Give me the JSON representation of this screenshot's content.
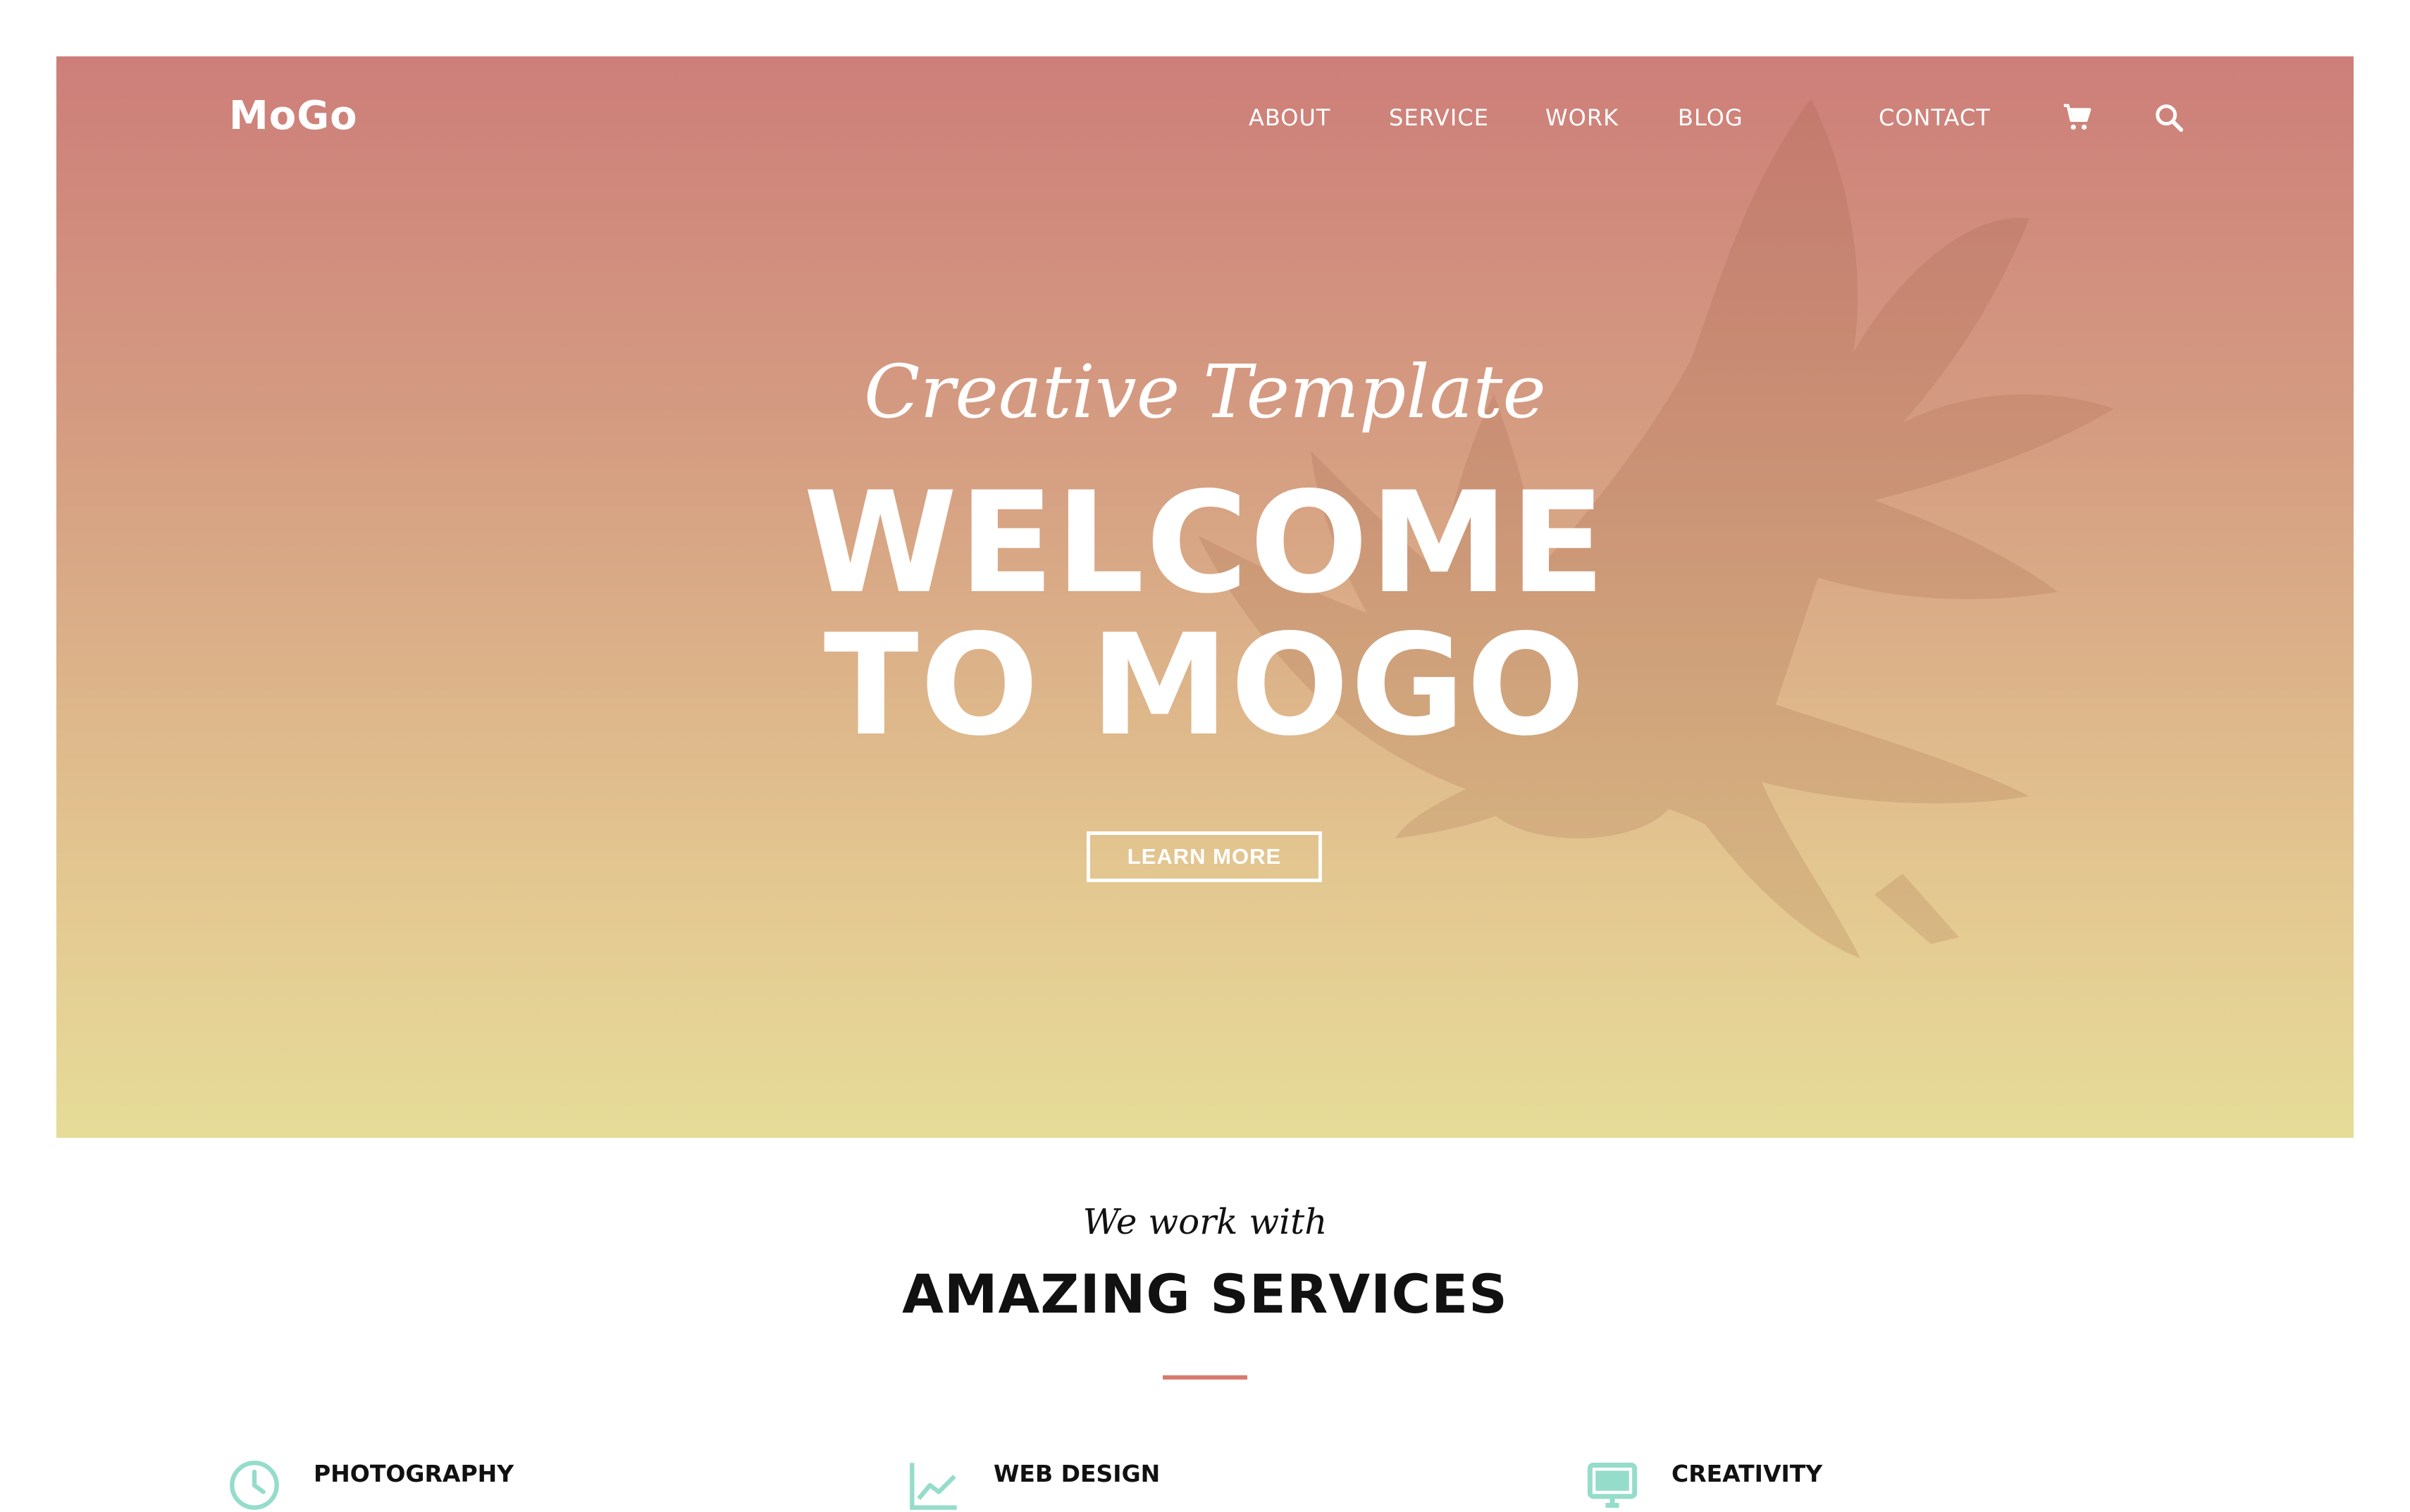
{
  "brand": {
    "logo_text": "MoGo"
  },
  "nav": {
    "items": [
      {
        "label": "ABOUT"
      },
      {
        "label": "SERVICE"
      },
      {
        "label": "WORK"
      },
      {
        "label": "BLOG"
      },
      {
        "label": "CONTACT"
      }
    ],
    "icons": [
      "cart-icon",
      "search-icon"
    ]
  },
  "hero": {
    "tagline": "Creative Template",
    "headline_line1": "WELCOME",
    "headline_line2": "TO MOGO",
    "cta_label": "LEARN MORE",
    "background_icon": "eagle-silhouette",
    "gradient_top": "#cd7e79",
    "gradient_bottom": "#e6dc98"
  },
  "services": {
    "pretitle": "We work with",
    "title": "AMAZING SERVICES",
    "divider_color": "#d77b6d",
    "items": [
      {
        "label": "PHOTOGRAPHY",
        "icon": "clock-icon"
      },
      {
        "label": "WEB DESIGN",
        "icon": "line-chart-icon"
      },
      {
        "label": "CREATIVITY",
        "icon": "monitor-icon"
      }
    ],
    "icon_color": "#95dccb"
  }
}
